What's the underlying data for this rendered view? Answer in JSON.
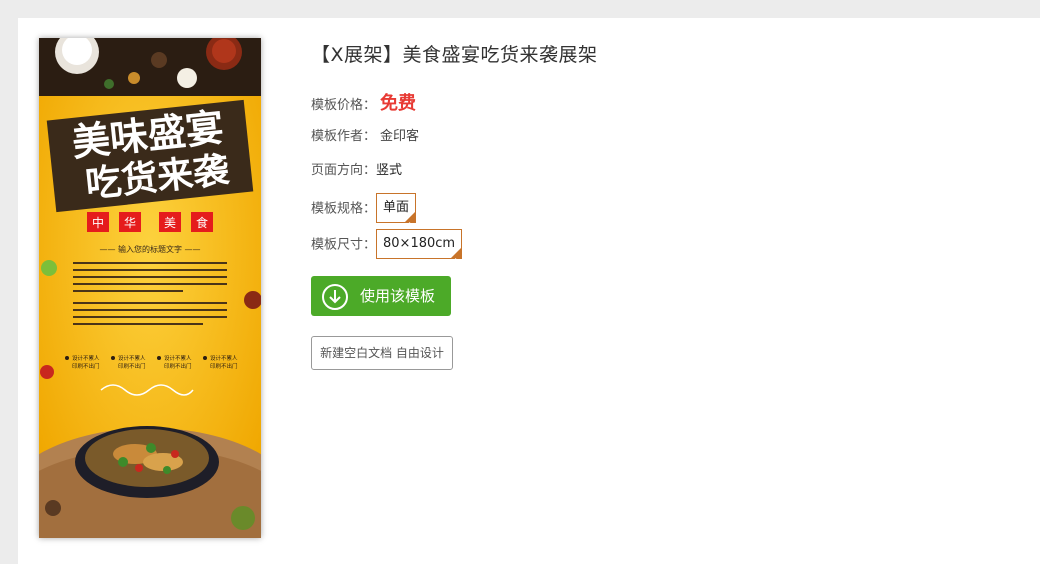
{
  "poster": {
    "headline_top": "美味盛宴",
    "headline_bottom": "吃货来袭",
    "badges": [
      "中",
      "华",
      "美",
      "食"
    ],
    "subtitle": "—— 输入您的标题文字 ——",
    "bullets": [
      "设计不累人",
      "设计不累人",
      "设计不累人",
      "设计不累人"
    ],
    "bullet_subs": [
      "印刷不出门",
      "印刷不出门",
      "印刷不出门",
      "印刷不出门"
    ]
  },
  "detail": {
    "title": "【X展架】美食盛宴吃货来袭展架",
    "price_label": "模板价格：",
    "price_value": "免费",
    "author_label": "模板作者：",
    "author_value": "金印客",
    "orientation_label": "页面方向：",
    "orientation_value": "竖式",
    "spec_label": "模板规格：",
    "spec_value": "单面",
    "size_label": "模板尺寸：",
    "size_value": "80×180cm",
    "use_button": "使用该模板",
    "blank_button": "新建空白文档 自由设计"
  },
  "colors": {
    "accent_green": "#4caa28",
    "price_red": "#e83a34",
    "tag_border": "#c8742a",
    "poster_yellow": "#f6b80f"
  },
  "icons": {
    "use_button_icon": "download-arrow-circle-icon"
  }
}
